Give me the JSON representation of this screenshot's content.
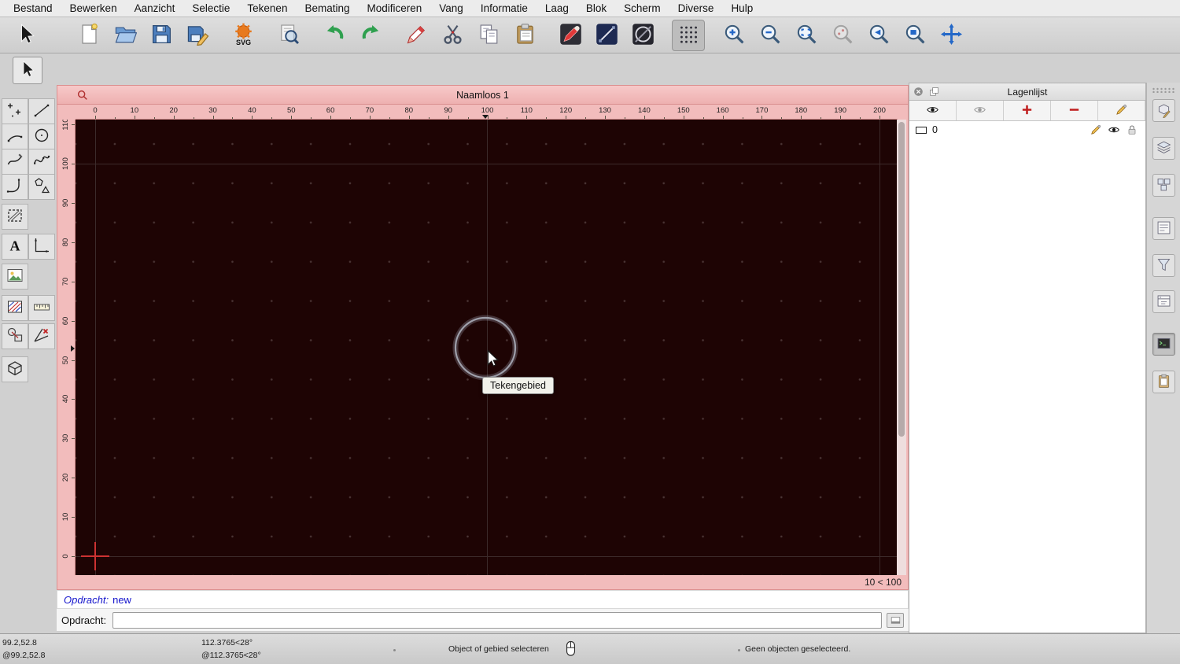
{
  "menubar": {
    "items": [
      "Bestand",
      "Bewerken",
      "Aanzicht",
      "Selectie",
      "Tekenen",
      "Bemating",
      "Modificeren",
      "Vang",
      "Informatie",
      "Laag",
      "Blok",
      "Scherm",
      "Diverse",
      "Hulp"
    ]
  },
  "toolbar": {
    "buttons": [
      {
        "name": "selection-tool",
        "icon": "arrow-black",
        "gap_wide": true
      },
      {
        "name": "new-document",
        "icon": "new-doc"
      },
      {
        "name": "open-document",
        "icon": "open-folder"
      },
      {
        "name": "save-document",
        "icon": "save"
      },
      {
        "name": "save-as",
        "icon": "save-as",
        "group_end": true
      },
      {
        "name": "svg-export",
        "icon": "svg",
        "group_end": true
      },
      {
        "name": "print-preview",
        "icon": "print-preview",
        "group_end": true
      },
      {
        "name": "undo",
        "icon": "undo"
      },
      {
        "name": "redo",
        "icon": "redo",
        "group_end": true
      },
      {
        "name": "draw-pencil",
        "icon": "pencil-red"
      },
      {
        "name": "cut",
        "icon": "cut"
      },
      {
        "name": "copy",
        "icon": "copy"
      },
      {
        "name": "paste",
        "icon": "paste",
        "group_end": true
      },
      {
        "name": "pen-attributes",
        "icon": "pen-attr"
      },
      {
        "name": "line-attributes",
        "icon": "line-attr"
      },
      {
        "name": "ellipse-attributes",
        "icon": "circle-attr",
        "group_end": true
      },
      {
        "name": "grid-toggle",
        "icon": "grid",
        "pressed": true,
        "group_end": true
      },
      {
        "name": "zoom-in",
        "icon": "zoom-in"
      },
      {
        "name": "zoom-out",
        "icon": "zoom-out"
      },
      {
        "name": "zoom-auto",
        "icon": "zoom-auto"
      },
      {
        "name": "zoom-all",
        "icon": "zoom-all",
        "disabled": true
      },
      {
        "name": "zoom-previous",
        "icon": "zoom-prev"
      },
      {
        "name": "zoom-window",
        "icon": "zoom-window"
      },
      {
        "name": "zoom-pan",
        "icon": "pan"
      }
    ]
  },
  "left_palette": {
    "current_tool": {
      "name": "selection-tool",
      "icon": "arrow-black"
    },
    "rows": [
      [
        {
          "name": "point-tool",
          "icon": "point"
        },
        {
          "name": "line-tool",
          "icon": "line"
        }
      ],
      [
        {
          "name": "arc-tool",
          "icon": "arc"
        },
        {
          "name": "circle-tool",
          "icon": "circle"
        }
      ],
      [
        {
          "name": "freehand-tool",
          "icon": "freehand"
        },
        {
          "name": "spline-tool",
          "icon": "spline"
        }
      ],
      [
        {
          "name": "polyline-tool",
          "icon": "polyline"
        },
        {
          "name": "polygon-tool",
          "icon": "polygon"
        }
      ],
      [
        {
          "name": "hatch-tool",
          "icon": "hatch"
        },
        null
      ],
      [
        {
          "name": "text-tool",
          "icon": "text"
        },
        {
          "name": "dimension-tool",
          "icon": "dimension"
        }
      ],
      [
        {
          "name": "image-tool",
          "icon": "image"
        },
        null
      ],
      [
        {
          "name": "hatch-attributes-tool",
          "icon": "fill"
        },
        {
          "name": "measure-tool",
          "icon": "measure"
        }
      ],
      [
        {
          "name": "info-tool",
          "icon": "info"
        },
        {
          "name": "snap-tool",
          "icon": "snap"
        }
      ],
      [
        {
          "name": "solid-tool",
          "icon": "solid"
        },
        null
      ]
    ]
  },
  "document": {
    "title": "Naamloos 1",
    "zoom_status": "10 < 100",
    "tooltip": "Tekengebied",
    "ruler_h_labels": [
      "0",
      "10",
      "20",
      "30",
      "40",
      "50",
      "60",
      "70",
      "80",
      "90",
      "100",
      "110",
      "120",
      "130",
      "140",
      "150",
      "160",
      "170",
      "180",
      "190",
      "200"
    ],
    "ruler_v_labels": [
      "110",
      "100",
      "90",
      "80",
      "70",
      "60",
      "50",
      "40",
      "30",
      "20",
      "10",
      "0"
    ]
  },
  "layer_panel": {
    "title": "Lagenlijst",
    "toolbar": [
      {
        "name": "show-all-layers",
        "icon": "eye"
      },
      {
        "name": "hide-all-layers",
        "icon": "eye-gray"
      },
      {
        "name": "add-layer",
        "icon": "plus-red"
      },
      {
        "name": "remove-layer",
        "icon": "minus-red"
      },
      {
        "name": "edit-layer",
        "icon": "pencil-edit"
      }
    ],
    "layers": [
      {
        "name": "0"
      }
    ]
  },
  "right_strip": {
    "panels": [
      {
        "name": "panel-property-editor",
        "icon": "panel-prop"
      },
      {
        "name": "panel-layer-list",
        "icon": "panel-layers"
      },
      {
        "name": "panel-block-list",
        "icon": "panel-blocks"
      },
      {
        "name": "panel-library-browser",
        "icon": "panel-library"
      },
      {
        "name": "panel-selection-filter",
        "icon": "panel-filter"
      },
      {
        "name": "panel-view-list",
        "icon": "panel-views"
      },
      {
        "name": "panel-command-line",
        "icon": "panel-command",
        "active": true
      },
      {
        "name": "panel-clipboard",
        "icon": "panel-clipboard"
      }
    ]
  },
  "command": {
    "history_prompt": "Opdracht:",
    "history_value": "new",
    "prompt_label": "Opdracht:",
    "input_value": ""
  },
  "statusbar": {
    "abs_cartesian": "99.2,52.8",
    "rel_cartesian": "@99.2,52.8",
    "abs_polar": "112.3765<28°",
    "rel_polar": "@112.3765<28°",
    "hint": "Object of gebied selecteren",
    "selection_info": "Geen objecten geselecteerd."
  },
  "colors": {
    "canvas_bg": "#1e0404",
    "frame_pink": "#f2bcbc",
    "accent_blue": "#2468c8",
    "command_blue": "#1515cc"
  }
}
